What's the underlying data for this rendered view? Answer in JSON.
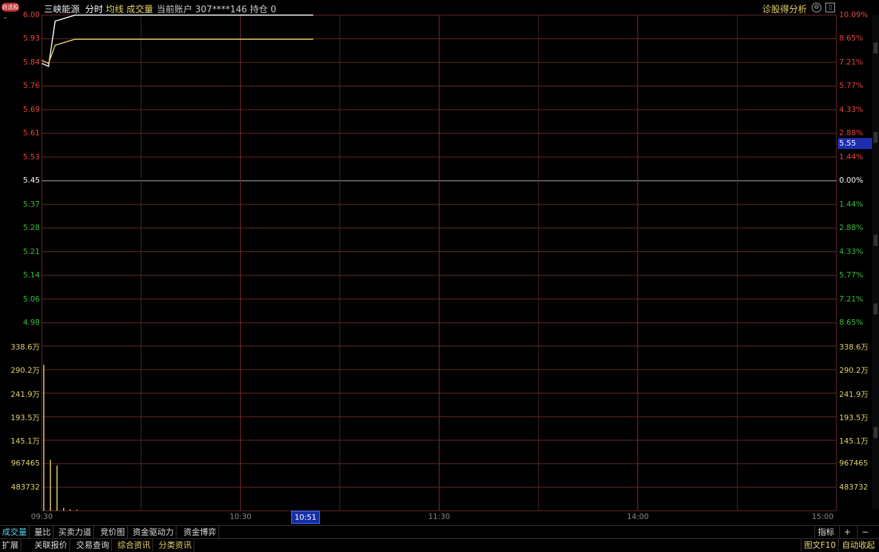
{
  "header": {
    "badge": "自选股",
    "stock_name": "三峡能源",
    "tab_timeshare": "分时",
    "tab_avg": "均线",
    "tab_volume": "成交量",
    "account": "当前账户 307****146 持仓 0",
    "analysis": "诊股得分析",
    "settings_icon": "gear-icon",
    "window_icon": "panel-icon"
  },
  "price_axis": {
    "left_labels": [
      "6.00",
      "5.93",
      "5.84",
      "5.76",
      "5.69",
      "5.61",
      "5.53",
      "5.45",
      "5.37",
      "5.28",
      "5.21",
      "5.14",
      "5.06",
      "4.98"
    ],
    "right_labels": [
      "10.09%",
      "8.65%",
      "7.21%",
      "5.77%",
      "4.33%",
      "2.88%",
      "1.44%",
      "0.00%",
      "1.44%",
      "2.88%",
      "4.33%",
      "5.77%",
      "7.21%",
      "8.65%"
    ],
    "current_price": "5.55"
  },
  "volume_axis": {
    "left_labels": [
      "338.6万",
      "290.2万",
      "241.9万",
      "193.5万",
      "145.1万",
      "967465",
      "483732"
    ],
    "right_labels": [
      "338.6万",
      "290.2万",
      "241.9万",
      "193.5万",
      "145.1万",
      "967465",
      "483732"
    ]
  },
  "time_axis": {
    "labels": [
      "09:30",
      "10:30",
      "11:30",
      "14:00",
      "15:00"
    ],
    "cursor": "10:51"
  },
  "colors": {
    "up": "#e8453c",
    "down": "#3cbf3c",
    "flat": "#ffffff",
    "grid": "#6b2b2b",
    "price_line": "#ffffff",
    "avg_line": "#e6d36a",
    "volume_bar": "#e6d36a"
  },
  "chart_data": {
    "type": "line",
    "price_range": [
      4.98,
      6.0
    ],
    "prev_close": 5.45,
    "series": [
      {
        "values": [
          5.84,
          5.83,
          5.98,
          6.0,
          6.0,
          6.0,
          6.0,
          6.0
        ]
      },
      {
        "values": [
          5.85,
          5.84,
          5.9,
          5.92,
          5.92,
          5.92,
          5.92,
          5.92
        ]
      }
    ],
    "x_minutes": [
      0,
      2,
      4,
      10,
      40,
      80,
      81,
      82
    ],
    "volume": [
      3000000,
      1050000,
      930000,
      60000,
      30000,
      20000
    ],
    "volume_minutes": [
      0,
      2,
      4,
      6,
      8,
      10
    ],
    "volume_range": [
      0,
      3386000
    ]
  },
  "tabs_row1": [
    "成交量",
    "量比",
    "买卖力道",
    "竞价图",
    "资金驱动力",
    "资金博弈"
  ],
  "tabs_row2": [
    "扩展",
    "关联报价",
    "交易查询",
    "综合资讯",
    "分类资讯"
  ],
  "controls": {
    "indicator": "指标",
    "plus": "+",
    "minus": "−",
    "f10": "图文F10",
    "bottom_right": "自动收起"
  }
}
